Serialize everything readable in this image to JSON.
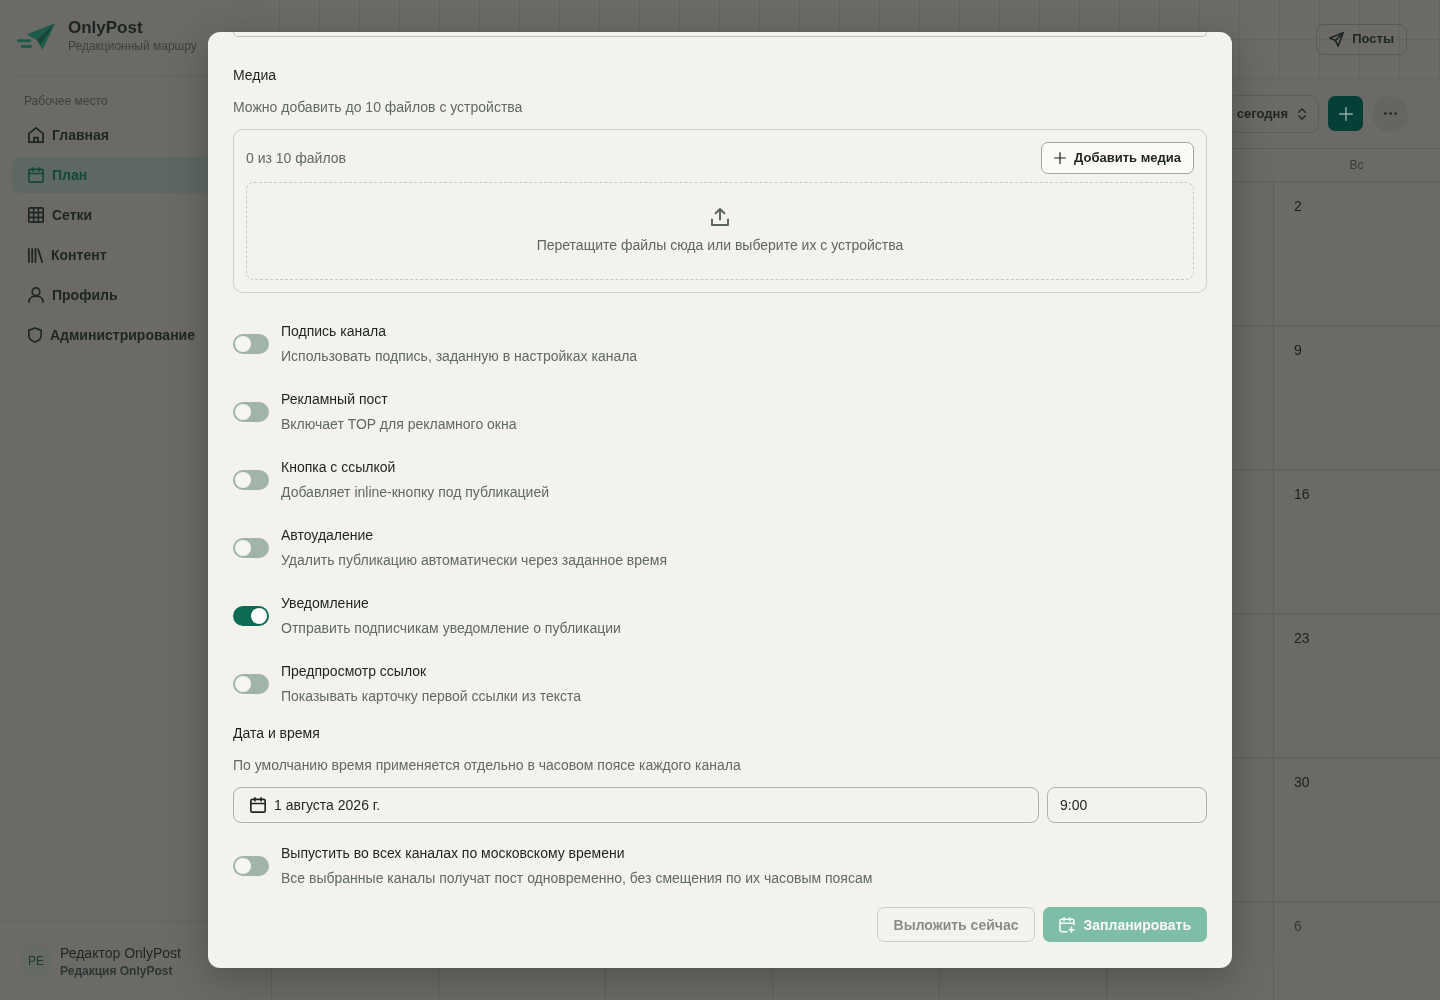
{
  "sidebar": {
    "brand": {
      "name": "OnlyPost",
      "tagline": "Редакционный маршру"
    },
    "section_label": "Рабочее место",
    "items": [
      {
        "label": "Главная",
        "selected": false
      },
      {
        "label": "План",
        "selected": true
      },
      {
        "label": "Сетки",
        "selected": false
      },
      {
        "label": "Контент",
        "selected": false
      },
      {
        "label": "Профиль",
        "selected": false
      },
      {
        "label": "Администрирование",
        "selected": false
      }
    ],
    "user": {
      "initials": "РЕ",
      "name": "Редактор OnlyPost",
      "team": "Редакция OnlyPost"
    }
  },
  "header": {
    "posts_button": "Посты"
  },
  "toolbar": {
    "range_select": "сегодня"
  },
  "calendar": {
    "weekday": "Вс",
    "days": [
      {
        "label": "2",
        "outside_month": false
      },
      {
        "label": "9",
        "outside_month": false
      },
      {
        "label": "16",
        "outside_month": false
      },
      {
        "label": "23",
        "outside_month": false
      },
      {
        "label": "30",
        "outside_month": false
      },
      {
        "label": "6",
        "outside_month": true
      }
    ]
  },
  "dialog": {
    "media": {
      "title": "Медиа",
      "hint": "Можно добавить до 10 файлов с устройства",
      "count": "0 из 10 файлов",
      "add_button": "Добавить медиа",
      "dropzone_text": "Перетащите файлы сюда или выберите их с устройства"
    },
    "options": [
      {
        "title": "Подпись канала",
        "description": "Использовать подпись, заданную в настройках канала",
        "checked": false
      },
      {
        "title": "Рекламный пост",
        "description": "Включает TOP для рекламного окна",
        "checked": false
      },
      {
        "title": "Кнопка с ссылкой",
        "description": "Добавляет inline-кнопку под публикацией",
        "checked": false
      },
      {
        "title": "Автоудаление",
        "description": "Удалить публикацию автоматически через заданное время",
        "checked": false
      },
      {
        "title": "Уведомление",
        "description": "Отправить подписчикам уведомление о публикации",
        "checked": true
      },
      {
        "title": "Предпросмотр ссылок",
        "description": "Показывать карточку первой ссылки из текста",
        "checked": false
      }
    ],
    "schedule": {
      "title": "Дата и время",
      "hint": "По умолчанию время применяется отдельно в часовом поясе каждого канала",
      "date": "1 августа 2026 г.",
      "time": "9:00"
    },
    "moscow_time": {
      "title": "Выпустить во всех каналах по московскому времени",
      "description": "Все выбранные каналы получат пост одновременно, без смещения по их часовым поясам",
      "checked": false
    },
    "actions": [
      {
        "kind": "secondary",
        "label": "Выложить сейчас",
        "disabled": true
      },
      {
        "kind": "primary",
        "label": "Запланировать",
        "disabled": true
      }
    ]
  }
}
